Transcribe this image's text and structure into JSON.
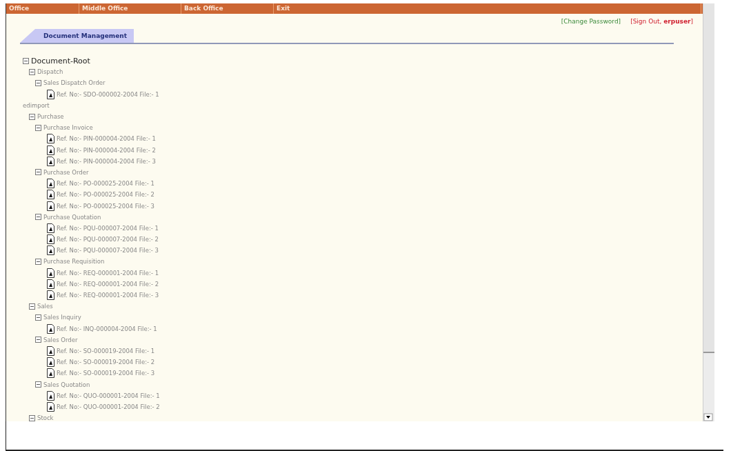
{
  "menu": [
    {
      "label": "Office"
    },
    {
      "label": "Middle Office"
    },
    {
      "label": "Back Office"
    },
    {
      "label": "Exit"
    }
  ],
  "user_links": {
    "change_password": "[Change Password]",
    "sign_out": "[Sign Out, **erpuser**]"
  },
  "tabs": [
    {
      "label": "Document Management",
      "selected": true
    }
  ],
  "tree": {
    "label": "Document-Root",
    "kind": "folder",
    "expanded": true,
    "children": [
      {
        "label": "Dispatch",
        "kind": "folder",
        "expanded": true,
        "children": [
          {
            "label": "Sales Dispatch Order",
            "kind": "folder",
            "expanded": true,
            "children": [
              {
                "label": "Ref. No:- SDO-000002-2004 File:- 1",
                "kind": "file"
              }
            ]
          }
        ]
      },
      {
        "label": "edimport",
        "kind": "leaf"
      },
      {
        "label": "Purchase",
        "kind": "folder",
        "expanded": true,
        "children": [
          {
            "label": "Purchase Invoice",
            "kind": "folder",
            "expanded": true,
            "children": [
              {
                "label": "Ref. No:- PIN-000004-2004 File:- 1",
                "kind": "file"
              },
              {
                "label": "Ref. No:- PIN-000004-2004 File:- 2",
                "kind": "file"
              },
              {
                "label": "Ref. No:- PIN-000004-2004 File:- 3",
                "kind": "file"
              }
            ]
          },
          {
            "label": "Purchase Order",
            "kind": "folder",
            "expanded": true,
            "children": [
              {
                "label": "Ref. No:- PO-000025-2004 File:- 1",
                "kind": "file"
              },
              {
                "label": "Ref. No:- PO-000025-2004 File:- 2",
                "kind": "file"
              },
              {
                "label": "Ref. No:- PO-000025-2004 File:- 3",
                "kind": "file"
              }
            ]
          },
          {
            "label": "Purchase Quotation",
            "kind": "folder",
            "expanded": true,
            "children": [
              {
                "label": "Ref. No:- PQU-000007-2004 File:- 1",
                "kind": "file"
              },
              {
                "label": "Ref. No:- PQU-000007-2004 File:- 2",
                "kind": "file"
              },
              {
                "label": "Ref. No:- PQU-000007-2004 File:- 3",
                "kind": "file"
              }
            ]
          },
          {
            "label": "Purchase Requisition",
            "kind": "folder",
            "expanded": true,
            "children": [
              {
                "label": "Ref. No:- REQ-000001-2004 File:- 1",
                "kind": "file"
              },
              {
                "label": "Ref. No:- REQ-000001-2004 File:- 2",
                "kind": "file"
              },
              {
                "label": "Ref. No:- REQ-000001-2004 File:- 3",
                "kind": "file"
              }
            ]
          }
        ]
      },
      {
        "label": "Sales",
        "kind": "folder",
        "expanded": true,
        "children": [
          {
            "label": "Sales Inquiry",
            "kind": "folder",
            "expanded": true,
            "children": [
              {
                "label": "Ref. No:- INQ-000004-2004 File:- 1",
                "kind": "file"
              }
            ]
          },
          {
            "label": "Sales Order",
            "kind": "folder",
            "expanded": true,
            "children": [
              {
                "label": "Ref. No:- SO-000019-2004 File:- 1",
                "kind": "file"
              },
              {
                "label": "Ref. No:- SO-000019-2004 File:- 2",
                "kind": "file"
              },
              {
                "label": "Ref. No:- SO-000019-2004 File:- 3",
                "kind": "file"
              }
            ]
          },
          {
            "label": "Sales Quotation",
            "kind": "folder",
            "expanded": true,
            "children": [
              {
                "label": "Ref. No:- QUO-000001-2004 File:- 1",
                "kind": "file"
              },
              {
                "label": "Ref. No:- QUO-000001-2004 File:- 2",
                "kind": "file"
              }
            ]
          }
        ]
      },
      {
        "label": "Stock",
        "kind": "folder",
        "expanded": true
      }
    ]
  }
}
